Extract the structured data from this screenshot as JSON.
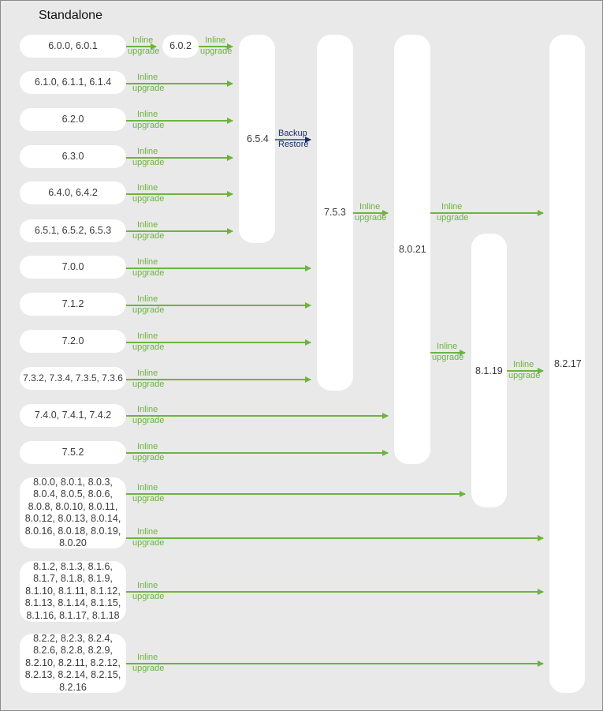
{
  "title": "Standalone",
  "labels": {
    "inline": "Inline",
    "upgrade": "upgrade",
    "backup": "Backup",
    "restore": "Restore"
  },
  "colors": {
    "arrow_inline": "#6db33f",
    "arrow_backup": "#1a2d6b",
    "background": "#e9e9e9",
    "node": "#ffffff"
  },
  "sources": [
    {
      "text": "6.0.0, 6.0.1",
      "target": "6.0.2"
    },
    {
      "text": "6.1.0, 6.1.1, 6.1.4",
      "target": "6.5.4"
    },
    {
      "text": "6.2.0",
      "target": "6.5.4"
    },
    {
      "text": "6.3.0",
      "target": "6.5.4"
    },
    {
      "text": "6.4.0, 6.4.2",
      "target": "6.5.4"
    },
    {
      "text": "6.5.1, 6.5.2, 6.5.3",
      "target": "6.5.4"
    },
    {
      "text": "7.0.0",
      "target": "7.5.3"
    },
    {
      "text": "7.1.2",
      "target": "7.5.3"
    },
    {
      "text": "7.2.0",
      "target": "7.5.3"
    },
    {
      "text": "7.3.2, 7.3.4, 7.3.5, 7.3.6",
      "target": "7.5.3"
    },
    {
      "text": "7.4.0, 7.4.1, 7.4.2",
      "target": "8.0.21"
    },
    {
      "text": "7.5.2",
      "target": "8.0.21"
    },
    {
      "text": "8.0.0, 8.0.1, 8.0.3, 8.0.4, 8.0.5, 8.0.6, 8.0.8, 8.0.10, 8.0.11, 8.0.12, 8.0.13, 8.0.14, 8.0.16, 8.0.18, 8.0.19, 8.0.20",
      "target": "8.1.19 / 8.2.17"
    },
    {
      "text": "8.1.2, 8.1.3, 8.1.6, 8.1.7, 8.1.8, 8.1.9, 8.1.10, 8.1.11, 8.1.12, 8.1.13, 8.1.14, 8.1.15, 8.1.16, 8.1.17, 8.1.18",
      "target": "8.2.17"
    },
    {
      "text": "8.2.2, 8.2.3, 8.2.4, 8.2.6, 8.2.8, 8.2.9, 8.2.10, 8.2.11, 8.2.12, 8.2.13, 8.2.14, 8.2.15, 8.2.16",
      "target": "8.2.17"
    }
  ],
  "intermediate": {
    "text": "6.0.2"
  },
  "columns": [
    {
      "text": "6.5.4"
    },
    {
      "text": "7.5.3"
    },
    {
      "text": "8.0.21"
    },
    {
      "text": "8.1.19"
    },
    {
      "text": "8.2.17"
    }
  ]
}
